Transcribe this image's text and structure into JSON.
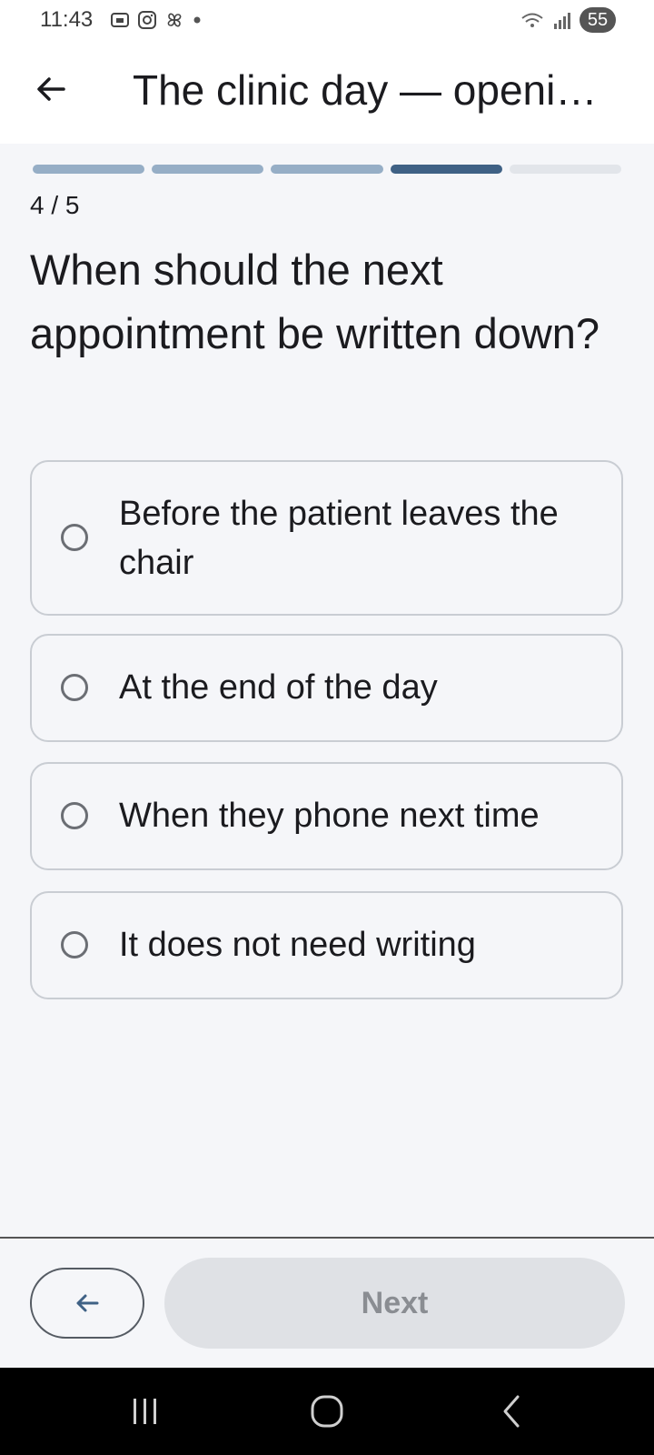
{
  "status": {
    "time": "11:43",
    "battery": "55"
  },
  "header": {
    "title": "The clinic day — openi…"
  },
  "progress": {
    "current": 4,
    "total": 5,
    "counter_text": "4 / 5"
  },
  "question": {
    "text": "When should the next appointment be written down?"
  },
  "options": [
    {
      "label": "Before the patient leaves the chair"
    },
    {
      "label": "At the end of the day"
    },
    {
      "label": "When they phone next time"
    },
    {
      "label": "It does not need writing"
    }
  ],
  "footer": {
    "next_label": "Next"
  },
  "colors": {
    "accent": "#3f6185",
    "done": "#96aec6",
    "pending": "#e2e5ea"
  }
}
